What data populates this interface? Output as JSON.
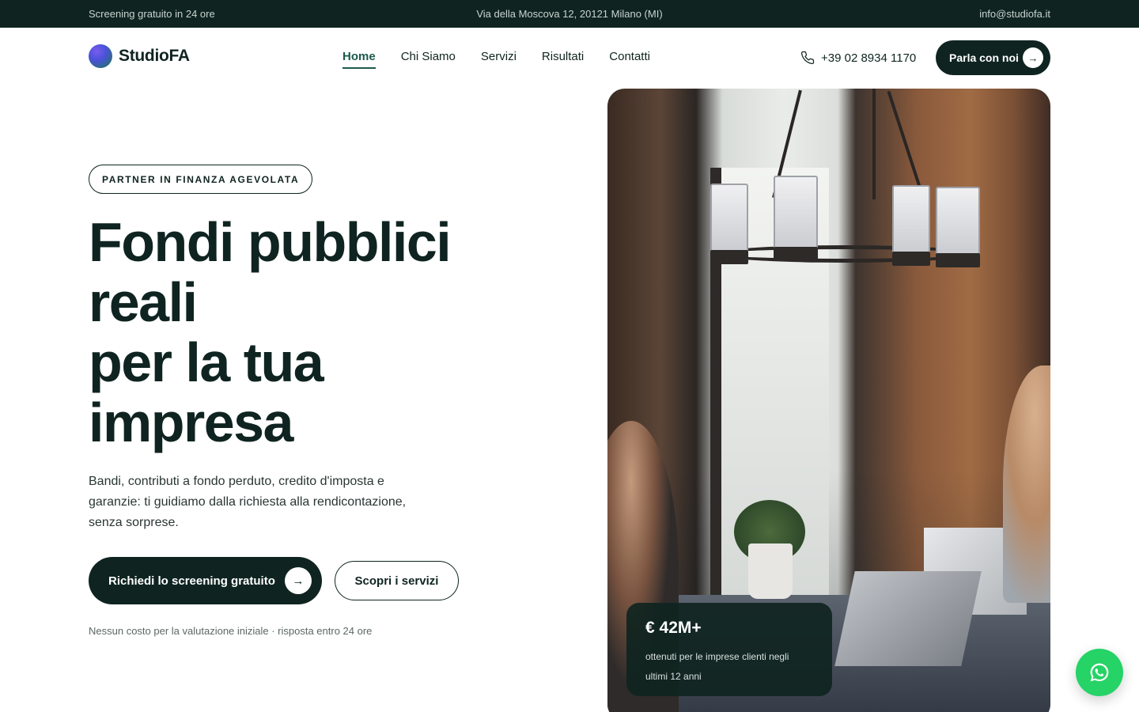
{
  "topbar": {
    "left": "Screening gratuito in 24 ore",
    "center": "Via della Moscova 12, 20121 Milano (MI)",
    "right": "info@studiofa.it"
  },
  "header": {
    "logo_text": "StudioFA",
    "nav": [
      {
        "label": "Home",
        "active": true
      },
      {
        "label": "Chi Siamo",
        "active": false
      },
      {
        "label": "Servizi",
        "active": false
      },
      {
        "label": "Risultati",
        "active": false
      },
      {
        "label": "Contatti",
        "active": false
      }
    ],
    "phone": "+39 02 8934 1170",
    "phone_icon": "phone-icon",
    "cta_label": "Parla con noi",
    "cta_icon": "arrow-right-icon"
  },
  "hero": {
    "badge": "PARTNER IN FINANZA AGEVOLATA",
    "headline_lines": [
      "Fondi pubblici",
      "reali",
      "per la tua",
      "impresa"
    ],
    "lead": "Bandi, contributi a fondo perduto, credito d'imposta e garanzie: ti guidiamo dalla richiesta alla rendicontazione, senza sorprese.",
    "primary_button": "Richiedi lo screening gratuito",
    "secondary_button": "Scopri i servizi",
    "note": "Nessun costo per la valutazione iniziale · risposta entro 24 ore"
  },
  "stat_card": {
    "value": "€ 42M+",
    "description": "ottenuti per le imprese clienti negli ultimi 12 anni"
  },
  "whatsapp": {
    "icon": "whatsapp-icon"
  },
  "colors": {
    "dark": "#0f2420",
    "accent": "#1d5a4c",
    "whatsapp": "#25d366"
  }
}
